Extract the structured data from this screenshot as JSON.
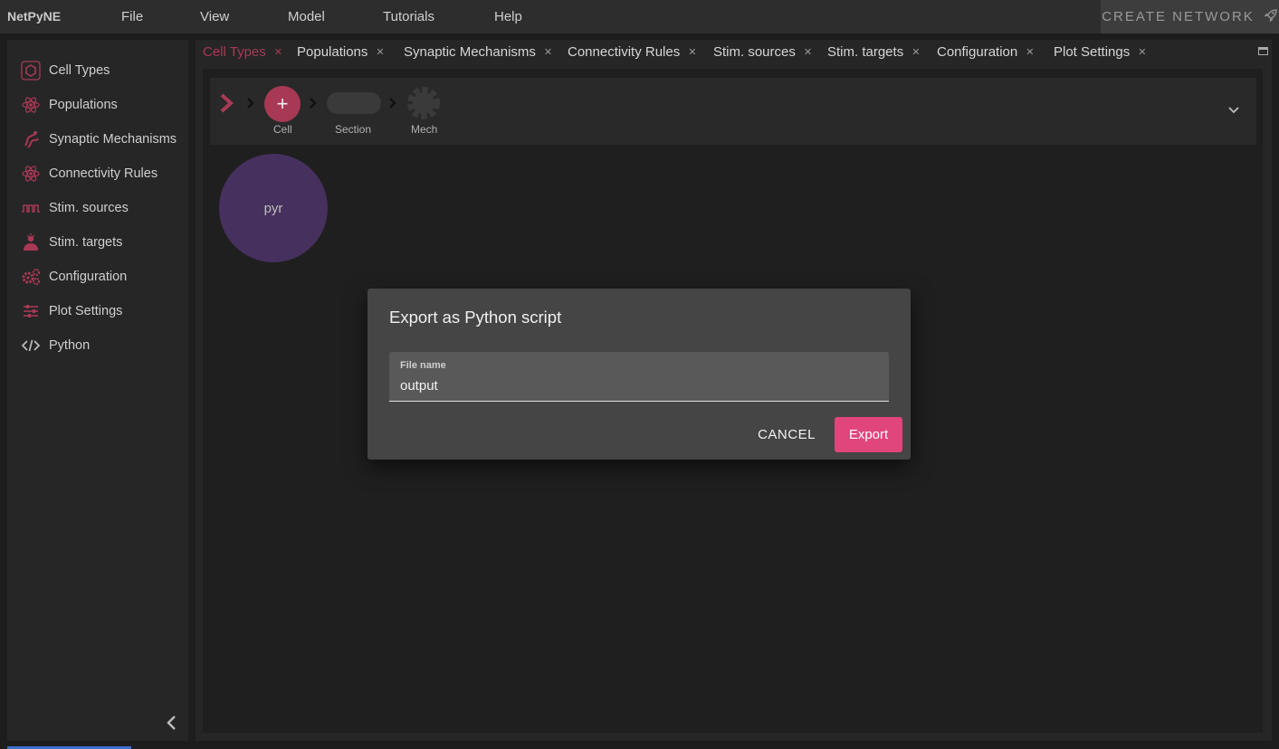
{
  "app": {
    "brand": "NetPyNE"
  },
  "menu": [
    "File",
    "View",
    "Model",
    "Tutorials",
    "Help"
  ],
  "create_network": {
    "label": "CREATE NETWORK",
    "icon": "rocket-icon"
  },
  "sidebar": {
    "items": [
      {
        "label": "Cell Types",
        "icon": "hexagon-icon"
      },
      {
        "label": "Populations",
        "icon": "atom-icon"
      },
      {
        "label": "Synaptic Mechanisms",
        "icon": "synapse-icon"
      },
      {
        "label": "Connectivity Rules",
        "icon": "atom-icon"
      },
      {
        "label": "Stim. sources",
        "icon": "pulse-wave-icon"
      },
      {
        "label": "Stim. targets",
        "icon": "target-person-icon"
      },
      {
        "label": "Configuration",
        "icon": "gears-icon"
      },
      {
        "label": "Plot Settings",
        "icon": "sliders-icon"
      },
      {
        "label": "Python",
        "icon": "code-icon"
      }
    ]
  },
  "tabs": [
    {
      "label": "Cell Types",
      "active": true
    },
    {
      "label": "Populations"
    },
    {
      "label": "Synaptic Mechanisms"
    },
    {
      "label": "Connectivity Rules"
    },
    {
      "label": "Stim. sources"
    },
    {
      "label": "Stim. targets"
    },
    {
      "label": "Configuration"
    },
    {
      "label": "Plot Settings"
    }
  ],
  "breadcrumb": {
    "add_symbol": "+",
    "cell_label": "Cell",
    "section_label": "Section",
    "mech_label": "Mech"
  },
  "cells": [
    {
      "name": "pyr"
    }
  ],
  "dialog": {
    "title": "Export as Python script",
    "field_label": "File name",
    "field_value": "output",
    "cancel_label": "CANCEL",
    "export_label": "Export"
  },
  "colors": {
    "accent": "#a83955",
    "export_button": "#e0457b",
    "cell_node": "#46305e"
  }
}
